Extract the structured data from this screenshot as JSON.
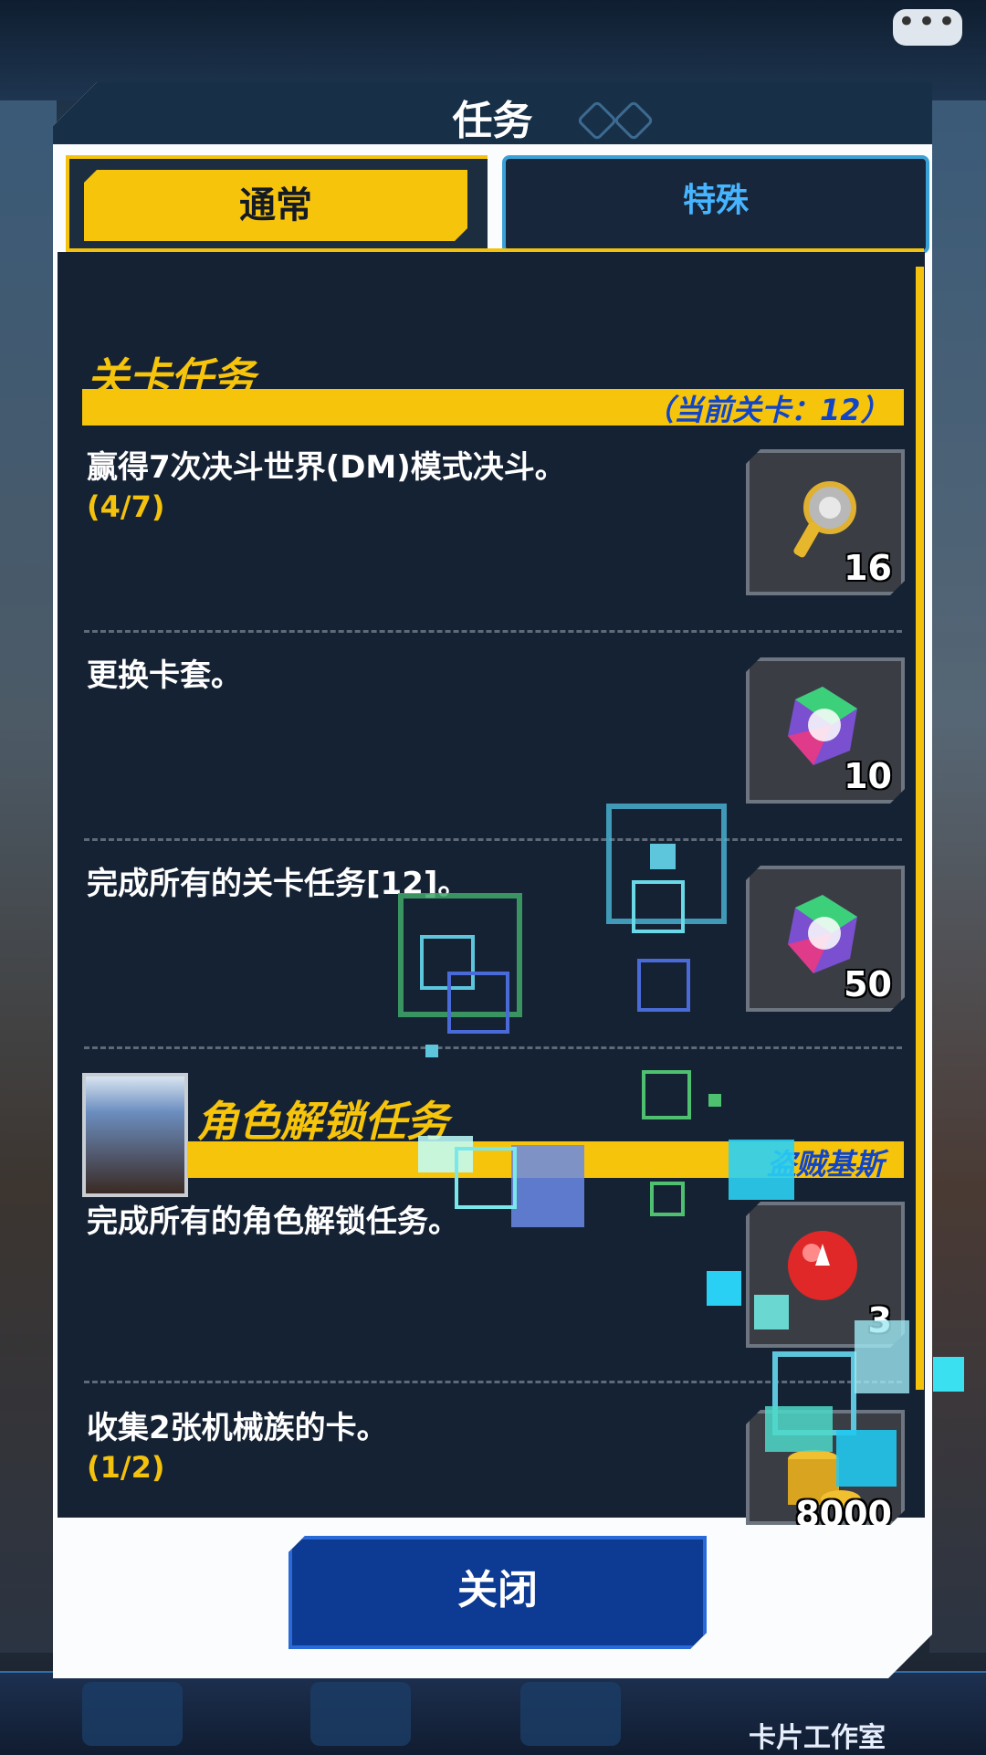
{
  "modal": {
    "title": "任务"
  },
  "tabs": [
    {
      "label": "通常",
      "active": true
    },
    {
      "label": "特殊",
      "active": false
    }
  ],
  "sections": [
    {
      "title": "关卡任务",
      "note": "（当前关卡：12）",
      "missions": [
        {
          "text": "赢得7次决斗世界(DM)模式决斗。",
          "progress": "(4/7)",
          "reward_icon": "gate-key-icon",
          "reward_count": "16"
        },
        {
          "text": "更换卡套。",
          "progress": "",
          "reward_icon": "gem-icon",
          "reward_count": "10"
        },
        {
          "text": "完成所有的关卡任务[12]。",
          "progress": "",
          "reward_icon": "gem-icon",
          "reward_count": "50"
        }
      ]
    },
    {
      "title": "角色解锁任务",
      "note": "盗贼基斯",
      "missions": [
        {
          "text": "完成所有的角色解锁任务。",
          "progress": "",
          "reward_icon": "fire-orb-icon",
          "reward_count": "3"
        },
        {
          "text": "收集2张机械族的卡。",
          "progress": "(1/2)",
          "reward_icon": "gold-coins-icon",
          "reward_count": "8000"
        }
      ]
    }
  ],
  "close_button": {
    "label": "关闭"
  },
  "background": {
    "bottom_nav_label": "卡片工作室",
    "chat_icon": "•••"
  },
  "colors": {
    "accent": "#f7c40c",
    "panel": "#152234",
    "note_blue": "#1145c8",
    "tab_special": "#46b4ff"
  }
}
